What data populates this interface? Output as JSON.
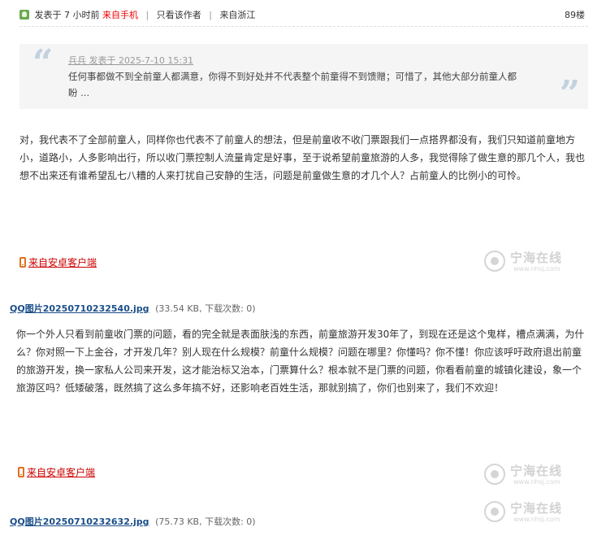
{
  "post_meta": {
    "posted": "发表于 7 小时前",
    "from_mobile": "来自手机",
    "only_author": "只看该作者",
    "location": "来自浙江",
    "floor": "89楼"
  },
  "quote": {
    "header": "兵兵 发表于 2025-7-10 15:31",
    "text": "任何事都做不到全前童人都满意，你得不到好处并不代表整个前童得不到馈赠；可惜了，其他大部分前童人都盼 ..."
  },
  "paragraphs": [
    "对，我代表不了全部前童人，同样你也代表不了前童人的想法，但是前童收不收门票跟我们一点搭界都没有，我们只知道前童地方小，道路小，人多影响出行，所以收门票控制人流量肯定是好事，至于说希望前童旅游的人多，我觉得除了做生意的那几个人，我也想不出来还有谁希望乱七八糟的人来打扰自己安静的生活，问题是前童做生意的才几个人？占前童人的比例小的可怜。",
    "你一个外人只看到前童收门票的问题，看的完全就是表面肤浅的东西，前童旅游开发30年了，到现在还是这个鬼样，槽点满满，为什么？你对照一下上金谷，才开发几年？别人现在什么规模？前童什么规模？问题在哪里？你懂吗？你不懂！你应该呼吁政府退出前童的旅游开发，换一家私人公司来开发，这才能治标又治本，门票算什么？根本就不是门票的问题，你看看前童的城镇化建设，象一个旅游区吗？低矮破落，既然搞了这么多年搞不好，还影响老百姓生活，那就别搞了，你们也别来了，我们不欢迎！"
  ],
  "client_link": "来自安卓客户端",
  "watermark": {
    "name": "宁海在线",
    "url": "www.nhsj.com"
  },
  "attachments": [
    {
      "name": "QQ图片20250710232540.jpg",
      "info": "(33.54 KB, 下载次数: 0)"
    },
    {
      "name": "QQ图片20250710232632.jpg",
      "info": "(75.73 KB, 下载次数: 0)"
    }
  ],
  "icons": {
    "online": "online-status-icon",
    "phone": "mobile-phone-icon",
    "quote_open": "quote-open-icon",
    "quote_close": "quote-close-icon",
    "watermark_logo": "site-logo-icon"
  },
  "colors": {
    "link_red": "#cc0000",
    "attachment_blue": "#1a4e8a",
    "quote_bg": "#f5f5f5"
  }
}
